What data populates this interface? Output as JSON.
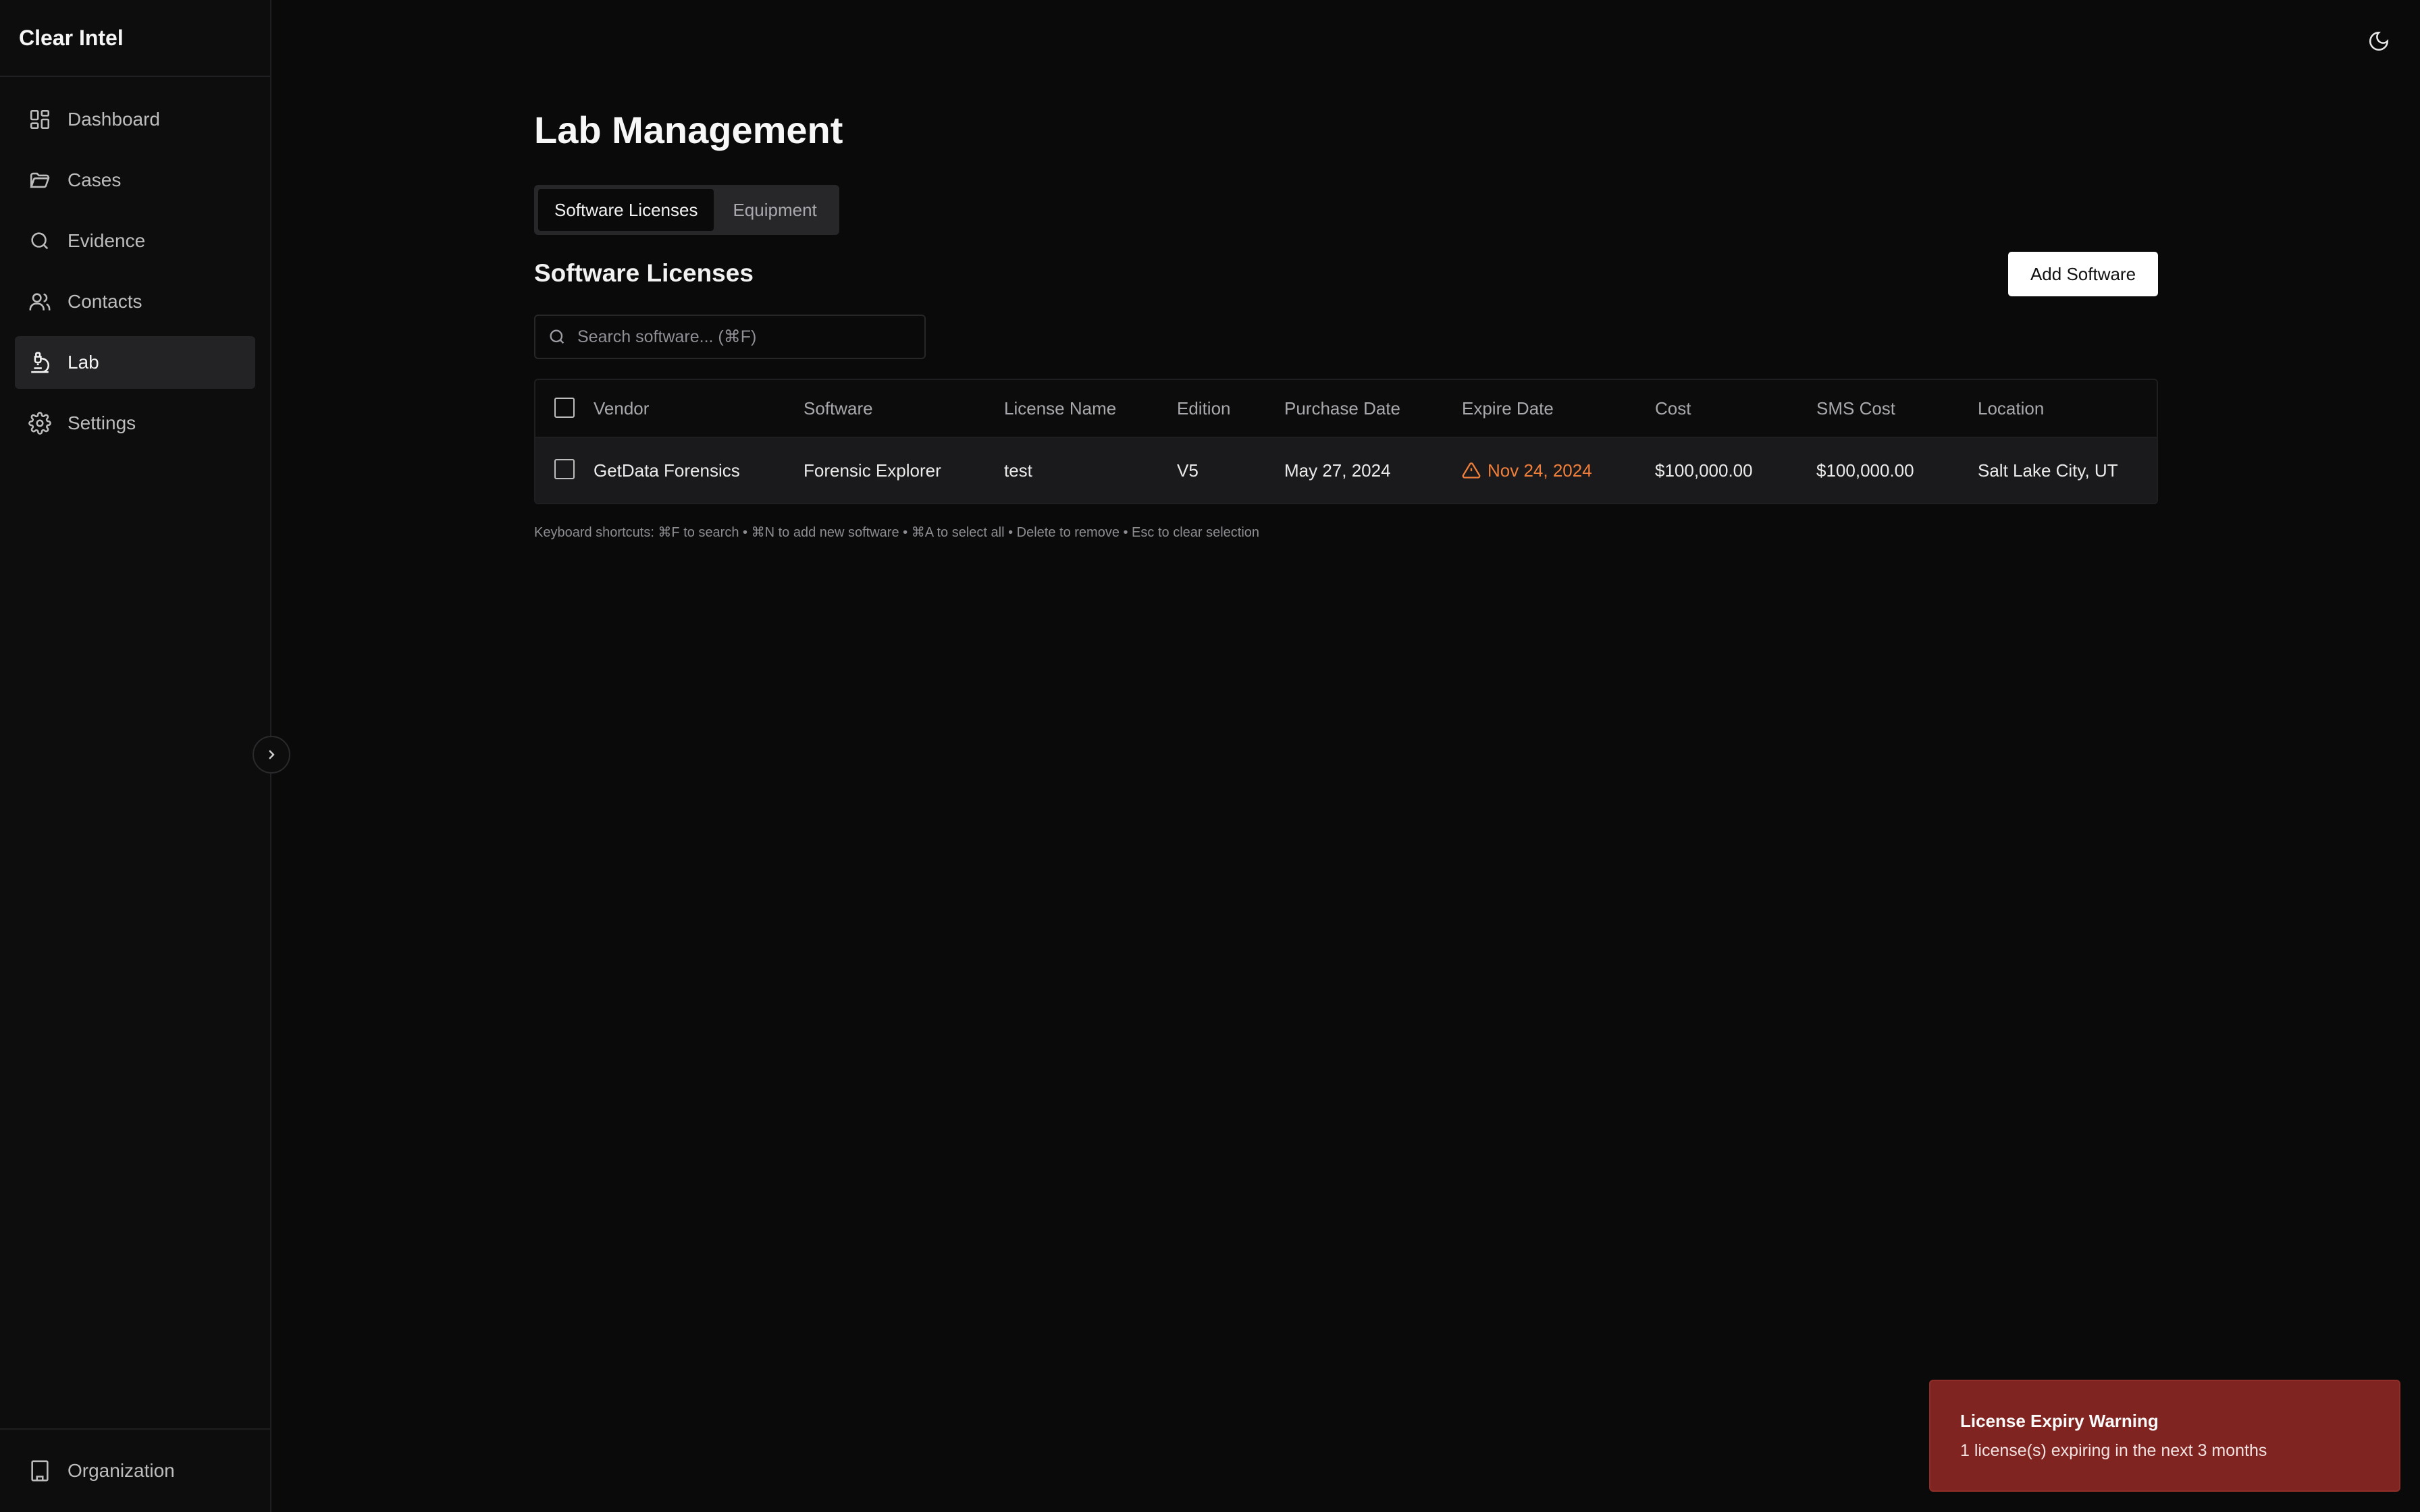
{
  "app": {
    "name": "Clear Intel"
  },
  "sidebar": {
    "items": [
      {
        "label": "Dashboard",
        "icon": "dashboard-icon"
      },
      {
        "label": "Cases",
        "icon": "folder-icon"
      },
      {
        "label": "Evidence",
        "icon": "search-icon"
      },
      {
        "label": "Contacts",
        "icon": "users-icon"
      },
      {
        "label": "Lab",
        "icon": "microscope-icon",
        "active": true
      },
      {
        "label": "Settings",
        "icon": "gear-icon"
      }
    ],
    "footer": {
      "label": "Organization",
      "icon": "building-icon"
    }
  },
  "header": {
    "theme_icon": "moon-icon"
  },
  "page": {
    "title": "Lab Management",
    "tabs": [
      {
        "label": "Software Licenses",
        "active": true
      },
      {
        "label": "Equipment",
        "active": false
      }
    ],
    "section_title": "Software Licenses",
    "add_button": "Add Software",
    "search": {
      "placeholder": "Search software... (⌘F)",
      "value": ""
    }
  },
  "table": {
    "columns": [
      "Vendor",
      "Software",
      "License Name",
      "Edition",
      "Purchase Date",
      "Expire Date",
      "Cost",
      "SMS Cost",
      "Location"
    ],
    "rows": [
      {
        "vendor": "GetData Forensics",
        "software": "Forensic Explorer",
        "license_name": "test",
        "edition": "V5",
        "purchase_date": "May 27, 2024",
        "expire_date": "Nov 24, 2024",
        "expire_warning": true,
        "cost": "$100,000.00",
        "sms_cost": "$100,000.00",
        "location": "Salt Lake City, UT"
      }
    ]
  },
  "shortcuts": "Keyboard shortcuts: ⌘F to search • ⌘N to add new software • ⌘A to select all • Delete to remove • Esc to clear selection",
  "toast": {
    "title": "License Expiry Warning",
    "message": "1 license(s) expiring in the next 3 months"
  },
  "colors": {
    "background": "#0a0a0b",
    "warning": "#f07f3c",
    "toast_bg": "#7f2420"
  }
}
